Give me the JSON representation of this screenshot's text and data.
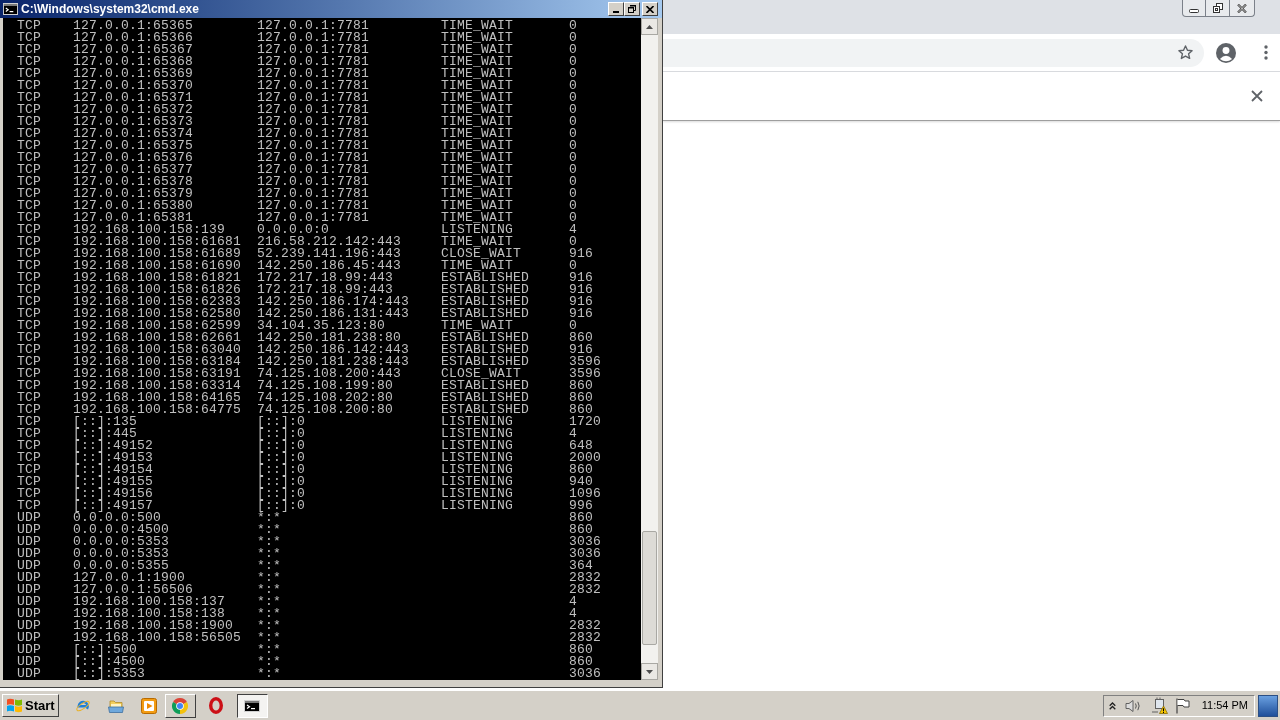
{
  "console_window": {
    "title": "C:\\Windows\\system32\\cmd.exe",
    "rows": [
      {
        "proto": "TCP",
        "local": "127.0.0.1:65365",
        "foreign": "127.0.0.1:7781",
        "state": "TIME_WAIT",
        "pid": "0"
      },
      {
        "proto": "TCP",
        "local": "127.0.0.1:65366",
        "foreign": "127.0.0.1:7781",
        "state": "TIME_WAIT",
        "pid": "0"
      },
      {
        "proto": "TCP",
        "local": "127.0.0.1:65367",
        "foreign": "127.0.0.1:7781",
        "state": "TIME_WAIT",
        "pid": "0"
      },
      {
        "proto": "TCP",
        "local": "127.0.0.1:65368",
        "foreign": "127.0.0.1:7781",
        "state": "TIME_WAIT",
        "pid": "0"
      },
      {
        "proto": "TCP",
        "local": "127.0.0.1:65369",
        "foreign": "127.0.0.1:7781",
        "state": "TIME_WAIT",
        "pid": "0"
      },
      {
        "proto": "TCP",
        "local": "127.0.0.1:65370",
        "foreign": "127.0.0.1:7781",
        "state": "TIME_WAIT",
        "pid": "0"
      },
      {
        "proto": "TCP",
        "local": "127.0.0.1:65371",
        "foreign": "127.0.0.1:7781",
        "state": "TIME_WAIT",
        "pid": "0"
      },
      {
        "proto": "TCP",
        "local": "127.0.0.1:65372",
        "foreign": "127.0.0.1:7781",
        "state": "TIME_WAIT",
        "pid": "0"
      },
      {
        "proto": "TCP",
        "local": "127.0.0.1:65373",
        "foreign": "127.0.0.1:7781",
        "state": "TIME_WAIT",
        "pid": "0"
      },
      {
        "proto": "TCP",
        "local": "127.0.0.1:65374",
        "foreign": "127.0.0.1:7781",
        "state": "TIME_WAIT",
        "pid": "0"
      },
      {
        "proto": "TCP",
        "local": "127.0.0.1:65375",
        "foreign": "127.0.0.1:7781",
        "state": "TIME_WAIT",
        "pid": "0"
      },
      {
        "proto": "TCP",
        "local": "127.0.0.1:65376",
        "foreign": "127.0.0.1:7781",
        "state": "TIME_WAIT",
        "pid": "0"
      },
      {
        "proto": "TCP",
        "local": "127.0.0.1:65377",
        "foreign": "127.0.0.1:7781",
        "state": "TIME_WAIT",
        "pid": "0"
      },
      {
        "proto": "TCP",
        "local": "127.0.0.1:65378",
        "foreign": "127.0.0.1:7781",
        "state": "TIME_WAIT",
        "pid": "0"
      },
      {
        "proto": "TCP",
        "local": "127.0.0.1:65379",
        "foreign": "127.0.0.1:7781",
        "state": "TIME_WAIT",
        "pid": "0"
      },
      {
        "proto": "TCP",
        "local": "127.0.0.1:65380",
        "foreign": "127.0.0.1:7781",
        "state": "TIME_WAIT",
        "pid": "0"
      },
      {
        "proto": "TCP",
        "local": "127.0.0.1:65381",
        "foreign": "127.0.0.1:7781",
        "state": "TIME_WAIT",
        "pid": "0"
      },
      {
        "proto": "TCP",
        "local": "192.168.100.158:139",
        "foreign": "0.0.0.0:0",
        "state": "LISTENING",
        "pid": "4"
      },
      {
        "proto": "TCP",
        "local": "192.168.100.158:61681",
        "foreign": "216.58.212.142:443",
        "state": "TIME_WAIT",
        "pid": "0"
      },
      {
        "proto": "TCP",
        "local": "192.168.100.158:61689",
        "foreign": "52.239.141.196:443",
        "state": "CLOSE_WAIT",
        "pid": "916"
      },
      {
        "proto": "TCP",
        "local": "192.168.100.158:61690",
        "foreign": "142.250.186.45:443",
        "state": "TIME_WAIT",
        "pid": "0"
      },
      {
        "proto": "TCP",
        "local": "192.168.100.158:61821",
        "foreign": "172.217.18.99:443",
        "state": "ESTABLISHED",
        "pid": "916"
      },
      {
        "proto": "TCP",
        "local": "192.168.100.158:61826",
        "foreign": "172.217.18.99:443",
        "state": "ESTABLISHED",
        "pid": "916"
      },
      {
        "proto": "TCP",
        "local": "192.168.100.158:62383",
        "foreign": "142.250.186.174:443",
        "state": "ESTABLISHED",
        "pid": "916"
      },
      {
        "proto": "TCP",
        "local": "192.168.100.158:62580",
        "foreign": "142.250.186.131:443",
        "state": "ESTABLISHED",
        "pid": "916"
      },
      {
        "proto": "TCP",
        "local": "192.168.100.158:62599",
        "foreign": "34.104.35.123:80",
        "state": "TIME_WAIT",
        "pid": "0"
      },
      {
        "proto": "TCP",
        "local": "192.168.100.158:62661",
        "foreign": "142.250.181.238:80",
        "state": "ESTABLISHED",
        "pid": "860"
      },
      {
        "proto": "TCP",
        "local": "192.168.100.158:63040",
        "foreign": "142.250.186.142:443",
        "state": "ESTABLISHED",
        "pid": "916"
      },
      {
        "proto": "TCP",
        "local": "192.168.100.158:63184",
        "foreign": "142.250.181.238:443",
        "state": "ESTABLISHED",
        "pid": "3596"
      },
      {
        "proto": "TCP",
        "local": "192.168.100.158:63191",
        "foreign": "74.125.108.200:443",
        "state": "CLOSE_WAIT",
        "pid": "3596"
      },
      {
        "proto": "TCP",
        "local": "192.168.100.158:63314",
        "foreign": "74.125.108.199:80",
        "state": "ESTABLISHED",
        "pid": "860"
      },
      {
        "proto": "TCP",
        "local": "192.168.100.158:64165",
        "foreign": "74.125.108.202:80",
        "state": "ESTABLISHED",
        "pid": "860"
      },
      {
        "proto": "TCP",
        "local": "192.168.100.158:64775",
        "foreign": "74.125.108.200:80",
        "state": "ESTABLISHED",
        "pid": "860"
      },
      {
        "proto": "TCP",
        "local": "[::]:135",
        "foreign": "[::]:0",
        "state": "LISTENING",
        "pid": "1720"
      },
      {
        "proto": "TCP",
        "local": "[::]:445",
        "foreign": "[::]:0",
        "state": "LISTENING",
        "pid": "4"
      },
      {
        "proto": "TCP",
        "local": "[::]:49152",
        "foreign": "[::]:0",
        "state": "LISTENING",
        "pid": "648"
      },
      {
        "proto": "TCP",
        "local": "[::]:49153",
        "foreign": "[::]:0",
        "state": "LISTENING",
        "pid": "2000"
      },
      {
        "proto": "TCP",
        "local": "[::]:49154",
        "foreign": "[::]:0",
        "state": "LISTENING",
        "pid": "860"
      },
      {
        "proto": "TCP",
        "local": "[::]:49155",
        "foreign": "[::]:0",
        "state": "LISTENING",
        "pid": "940"
      },
      {
        "proto": "TCP",
        "local": "[::]:49156",
        "foreign": "[::]:0",
        "state": "LISTENING",
        "pid": "1096"
      },
      {
        "proto": "TCP",
        "local": "[::]:49157",
        "foreign": "[::]:0",
        "state": "LISTENING",
        "pid": "996"
      },
      {
        "proto": "UDP",
        "local": "0.0.0.0:500",
        "foreign": "*:*",
        "pid": "860"
      },
      {
        "proto": "UDP",
        "local": "0.0.0.0:4500",
        "foreign": "*:*",
        "pid": "860"
      },
      {
        "proto": "UDP",
        "local": "0.0.0.0:5353",
        "foreign": "*:*",
        "pid": "3036"
      },
      {
        "proto": "UDP",
        "local": "0.0.0.0:5353",
        "foreign": "*:*",
        "pid": "3036"
      },
      {
        "proto": "UDP",
        "local": "0.0.0.0:5355",
        "foreign": "*:*",
        "pid": "364"
      },
      {
        "proto": "UDP",
        "local": "127.0.0.1:1900",
        "foreign": "*:*",
        "pid": "2832"
      },
      {
        "proto": "UDP",
        "local": "127.0.0.1:56506",
        "foreign": "*:*",
        "pid": "2832"
      },
      {
        "proto": "UDP",
        "local": "192.168.100.158:137",
        "foreign": "*:*",
        "pid": "4"
      },
      {
        "proto": "UDP",
        "local": "192.168.100.158:138",
        "foreign": "*:*",
        "pid": "4"
      },
      {
        "proto": "UDP",
        "local": "192.168.100.158:1900",
        "foreign": "*:*",
        "pid": "2832"
      },
      {
        "proto": "UDP",
        "local": "192.168.100.158:56505",
        "foreign": "*:*",
        "pid": "2832"
      },
      {
        "proto": "UDP",
        "local": "[::]:500",
        "foreign": "*:*",
        "pid": "860"
      },
      {
        "proto": "UDP",
        "local": "[::]:4500",
        "foreign": "*:*",
        "pid": "860"
      },
      {
        "proto": "UDP",
        "local": "[::]:5353",
        "foreign": "*:*",
        "pid": "3036"
      }
    ]
  },
  "taskbar": {
    "start_label": "Start",
    "tasks": [
      {
        "kind": "circle_logo",
        "raised": true,
        "selected": false
      },
      {
        "kind": "ring_logo",
        "raised": false,
        "selected": false
      },
      {
        "kind": "console",
        "selected": true
      }
    ],
    "clock": "11:54 PM"
  }
}
